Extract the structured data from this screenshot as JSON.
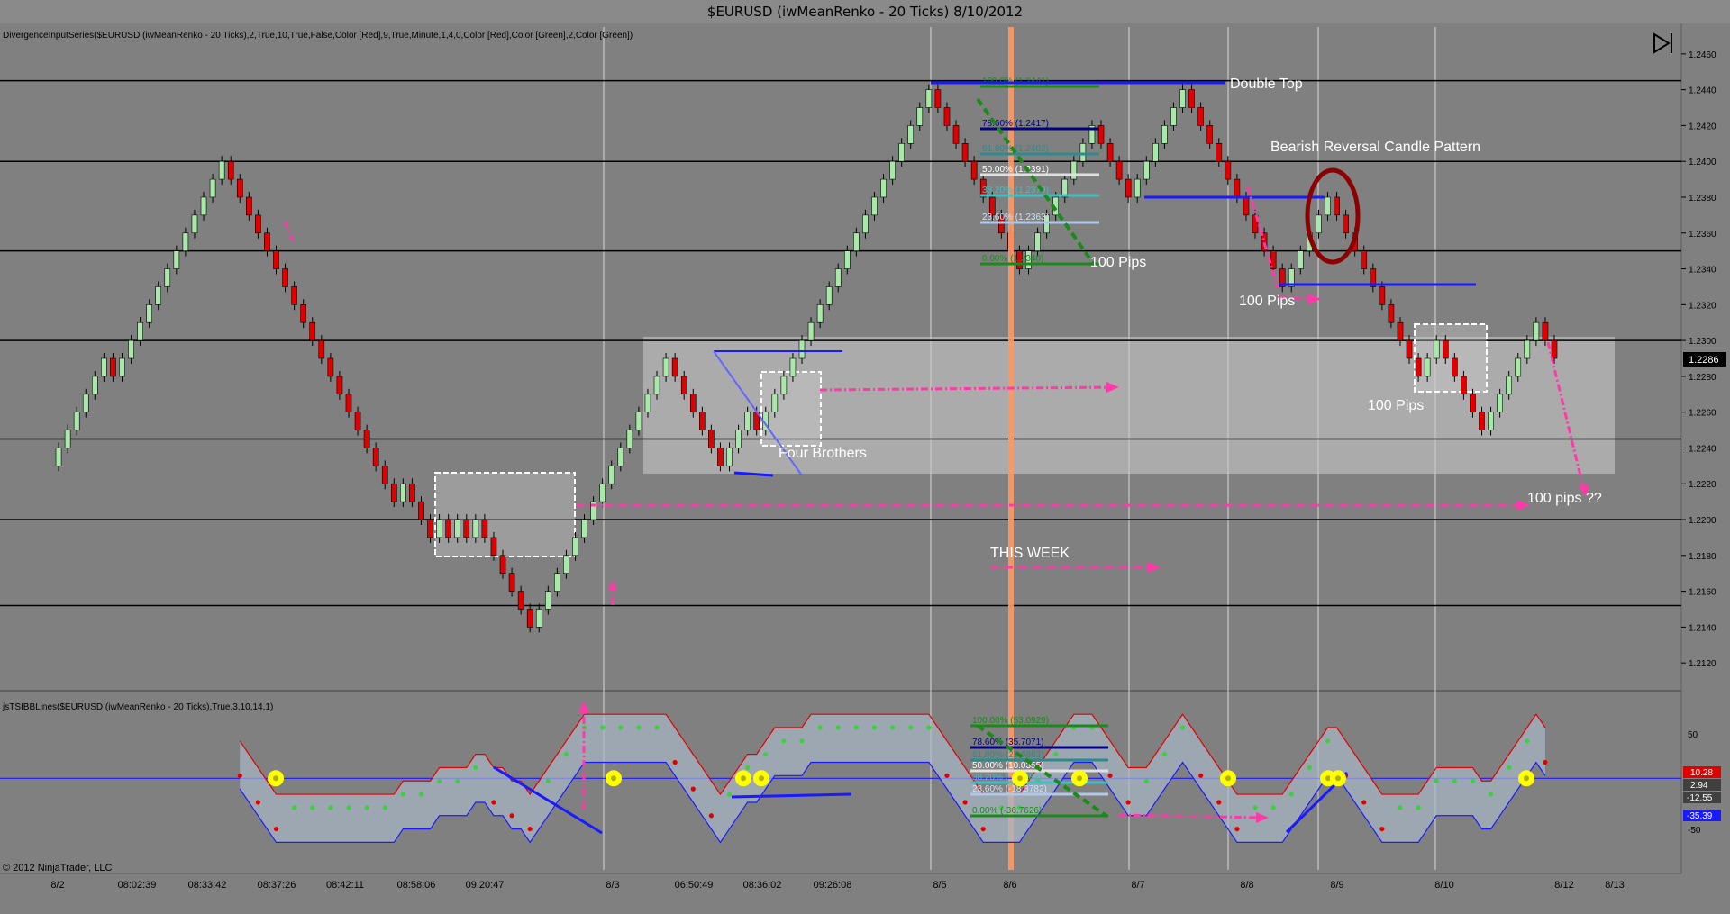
{
  "window_title": "$EURUSD (iwMeanRenko - 20 Ticks)  8/10/2012",
  "indicator_top_label": "DivergenceInputSeries($EURUSD (iwMeanRenko - 20 Ticks),2,True,10,True,False,Color [Red],9,True,Minute,1,4,0,Color [Red],Color [Green],2,Color [Green])",
  "indicator_bottom_label": "jsTSIBBLines($EURUSD (iwMeanRenko - 20 Ticks),True,3,10,14,1)",
  "copyright": "© 2012 NinjaTrader, LLC",
  "current_price": "1.2286",
  "colors": {
    "background": "#808080",
    "up_candle": "#a8e8a8",
    "down_candle": "#e00000",
    "magenta": "#ff3aa8",
    "blue": "#1a1aff",
    "orange": "#ff9966",
    "green": "#1a8a1a"
  },
  "annotations": {
    "double_top": "Double Top",
    "bearish": "Bearish Reversal Candle Pattern",
    "pips_1": "100 Pips",
    "pips_2": "100 Pips",
    "pips_3": "100 Pips",
    "pips_q": "100 pips ??",
    "four_brothers": "Four Brothers",
    "this_week": "THIS WEEK"
  },
  "fib_upper": [
    "100.0% (1.2441)",
    "78.60% (1.2417)",
    "61.80% (1.2402)",
    "50.00% (1.2391)",
    "38.20% (1.2379)",
    "23.60% (1.2363)",
    "0.00% (1.2340)"
  ],
  "fib_lower": [
    "100.00% (53.0929)",
    "78.60% (35.7071)",
    "61.80% (21.6883)",
    "50.00% (10.0355)",
    "38.20% (-3.3282)",
    "23.60% (-18.3782)",
    "0.00% (-36.7626)"
  ],
  "ind_axis_labels": [
    "50",
    "-50"
  ],
  "ind_markers": [
    {
      "label": "10.28",
      "color": "#e00000"
    },
    {
      "label": "2.94",
      "color": "#404040"
    },
    {
      "label": "-12.55",
      "color": "#404040"
    },
    {
      "label": "-35.39",
      "color": "#1a1aff"
    }
  ],
  "chart_data": {
    "type": "renko candlestick",
    "title": "$EURUSD (iwMeanRenko - 20 Ticks)  8/10/2012",
    "ylim": [
      1.2105,
      1.2475
    ],
    "y_ticks": [
      "1.2460",
      "1.2440",
      "1.2420",
      "1.2400",
      "1.2380",
      "1.2360",
      "1.2340",
      "1.2320",
      "1.2300",
      "1.2280",
      "1.2260",
      "1.2240",
      "1.2220",
      "1.2200",
      "1.2180",
      "1.2160",
      "1.2140",
      "1.2120"
    ],
    "x_ticks": [
      "8/2",
      "08:02:39",
      "08:33:42",
      "08:37:26",
      "08:42:11",
      "08:58:06",
      "09:20:47",
      "8/3",
      "06:50:49",
      "08:36:02",
      "09:26:08",
      "8/5",
      "8/6",
      "8/7",
      "8/8",
      "8/9",
      "8/10",
      "8/12",
      "8/13"
    ],
    "horizontal_levels": [
      1.2445,
      1.24,
      1.235,
      1.23,
      1.2245,
      1.22,
      1.2152
    ],
    "indicator_ylim": [
      -70,
      65
    ],
    "closes": [
      1.223,
      1.224,
      1.225,
      1.226,
      1.227,
      1.228,
      1.229,
      1.228,
      1.229,
      1.23,
      1.231,
      1.232,
      1.233,
      1.234,
      1.235,
      1.236,
      1.237,
      1.238,
      1.239,
      1.24,
      1.239,
      1.238,
      1.237,
      1.236,
      1.235,
      1.234,
      1.233,
      1.232,
      1.231,
      1.23,
      1.229,
      1.228,
      1.227,
      1.226,
      1.225,
      1.224,
      1.223,
      1.222,
      1.221,
      1.222,
      1.221,
      1.22,
      1.219,
      1.22,
      1.219,
      1.22,
      1.219,
      1.22,
      1.219,
      1.218,
      1.217,
      1.216,
      1.215,
      1.214,
      1.215,
      1.216,
      1.217,
      1.218,
      1.219,
      1.22,
      1.221,
      1.222,
      1.223,
      1.224,
      1.225,
      1.226,
      1.227,
      1.228,
      1.229,
      1.228,
      1.227,
      1.226,
      1.225,
      1.224,
      1.223,
      1.224,
      1.225,
      1.226,
      1.225,
      1.226,
      1.227,
      1.228,
      1.229,
      1.23,
      1.231,
      1.232,
      1.233,
      1.234,
      1.235,
      1.236,
      1.237,
      1.238,
      1.239,
      1.24,
      1.241,
      1.242,
      1.243,
      1.244,
      1.243,
      1.242,
      1.241,
      1.24,
      1.239,
      1.238,
      1.237,
      1.236,
      1.235,
      1.234,
      1.235,
      1.236,
      1.237,
      1.238,
      1.239,
      1.24,
      1.241,
      1.242,
      1.241,
      1.24,
      1.239,
      1.238,
      1.239,
      1.24,
      1.241,
      1.242,
      1.243,
      1.244,
      1.243,
      1.242,
      1.241,
      1.24,
      1.239,
      1.238,
      1.237,
      1.236,
      1.235,
      1.234,
      1.233,
      1.234,
      1.235,
      1.236,
      1.237,
      1.238,
      1.237,
      1.236,
      1.235,
      1.234,
      1.233,
      1.232,
      1.231,
      1.23,
      1.229,
      1.228,
      1.229,
      1.23,
      1.229,
      1.228,
      1.227,
      1.226,
      1.225,
      1.226,
      1.227,
      1.228,
      1.229,
      1.23,
      1.231,
      1.23,
      1.229
    ]
  }
}
